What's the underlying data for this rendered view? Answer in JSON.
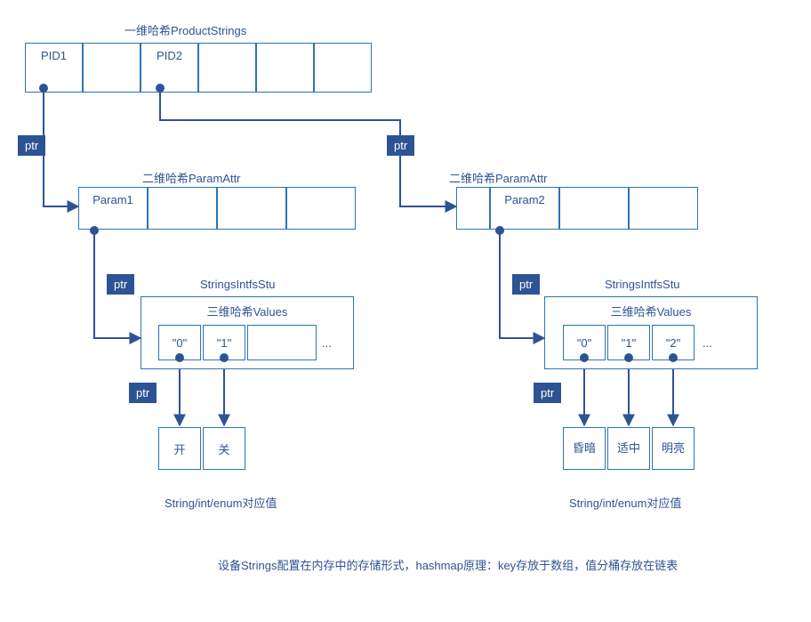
{
  "level1": {
    "title": "一维哈希ProductStrings",
    "cells": [
      "PID1",
      "",
      "PID2",
      "",
      "",
      ""
    ]
  },
  "ptr_label": "ptr",
  "left": {
    "level2_title": "二维哈希ParamAttr",
    "param_cells": [
      "Param1",
      "",
      "",
      ""
    ],
    "strings_title": "StringsIntfsStu",
    "values_title": "三维哈希Values",
    "value_cells": [
      "\"0\"",
      "\"1\"",
      "",
      "..."
    ],
    "results": [
      "开",
      "关"
    ],
    "footer": "String/int/enum对应值"
  },
  "right": {
    "level2_title": "二维哈希ParamAttr",
    "param_cells": [
      "Param2",
      "",
      "",
      ""
    ],
    "strings_title": "StringsIntfsStu",
    "values_title": "三维哈希Values",
    "value_cells": [
      "\"0\"",
      "\"1\"",
      "\"2\"",
      "..."
    ],
    "results": [
      "昏暗",
      "适中",
      "明亮"
    ],
    "footer": "String/int/enum对应值"
  },
  "bottom_caption": "设备Strings配置在内存中的存储形式，hashmap原理：key存放于数组，值分桶存放在链表"
}
